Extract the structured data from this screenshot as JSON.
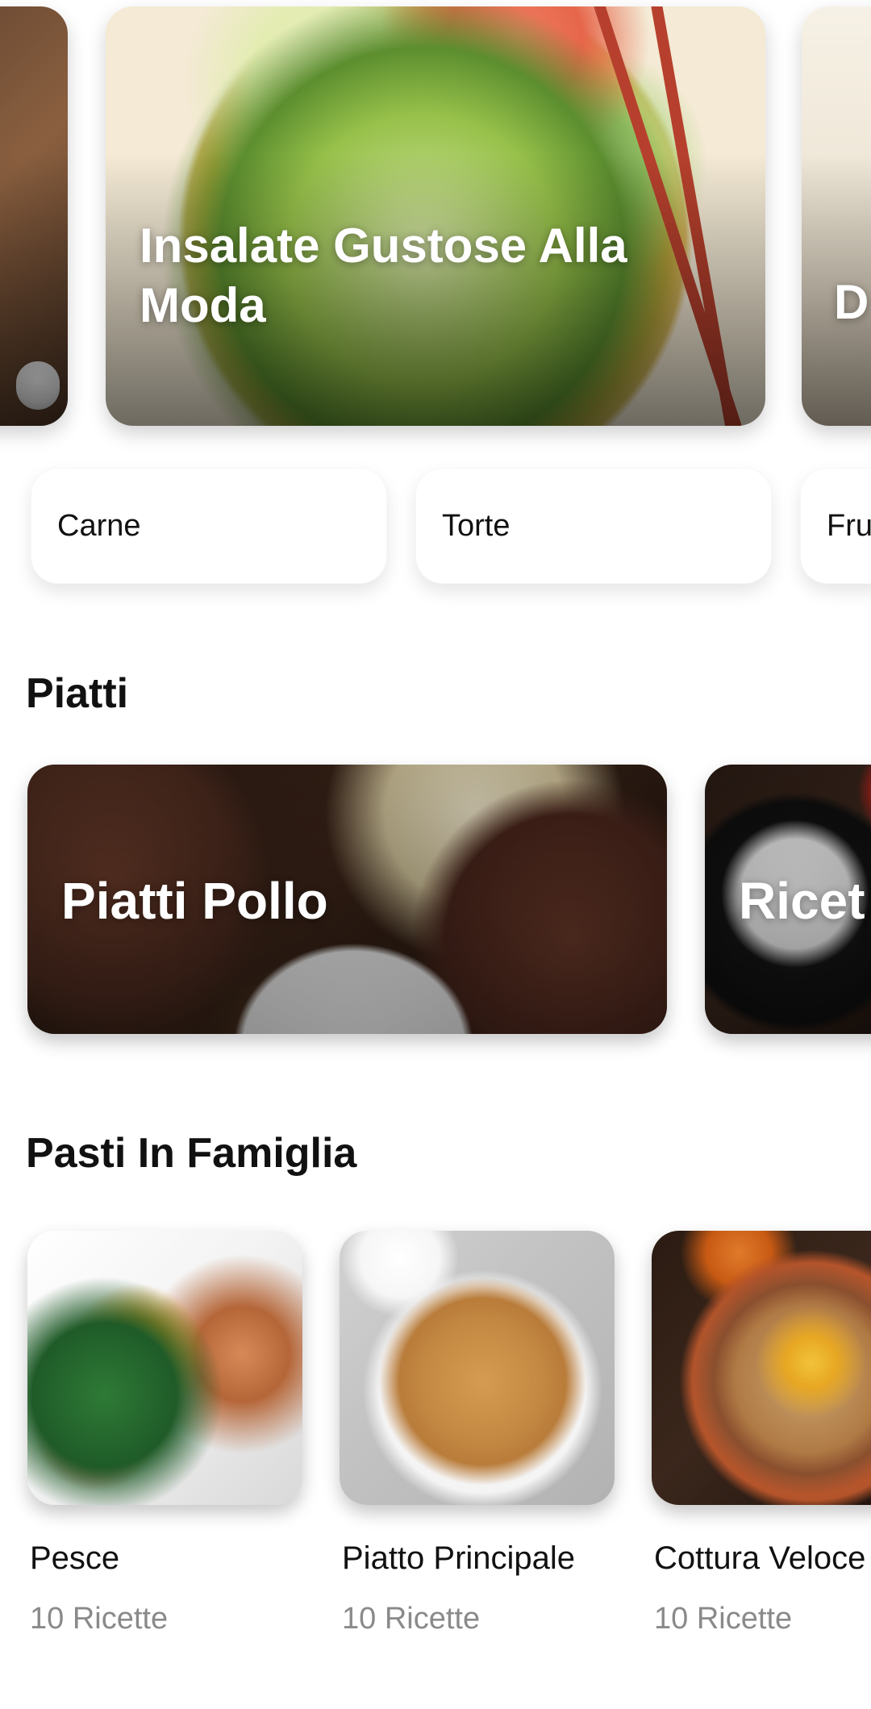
{
  "featured": [
    {
      "title": ""
    },
    {
      "title": "Insalate Gustose Alla Moda"
    },
    {
      "title": "D"
    }
  ],
  "categories": [
    {
      "label": "Carne"
    },
    {
      "label": "Torte"
    },
    {
      "label": "Fru"
    }
  ],
  "sections": {
    "dishes_title": "Piatti",
    "family_title": "Pasti In Famiglia"
  },
  "dishes": [
    {
      "title": "Piatti Pollo"
    },
    {
      "title": "Ricet"
    }
  ],
  "family_meals": [
    {
      "name": "Pesce",
      "count": "10 Ricette"
    },
    {
      "name": "Piatto Principale",
      "count": "10 Ricette"
    },
    {
      "name": "Cottura Veloce",
      "count": "10 Ricette"
    }
  ]
}
